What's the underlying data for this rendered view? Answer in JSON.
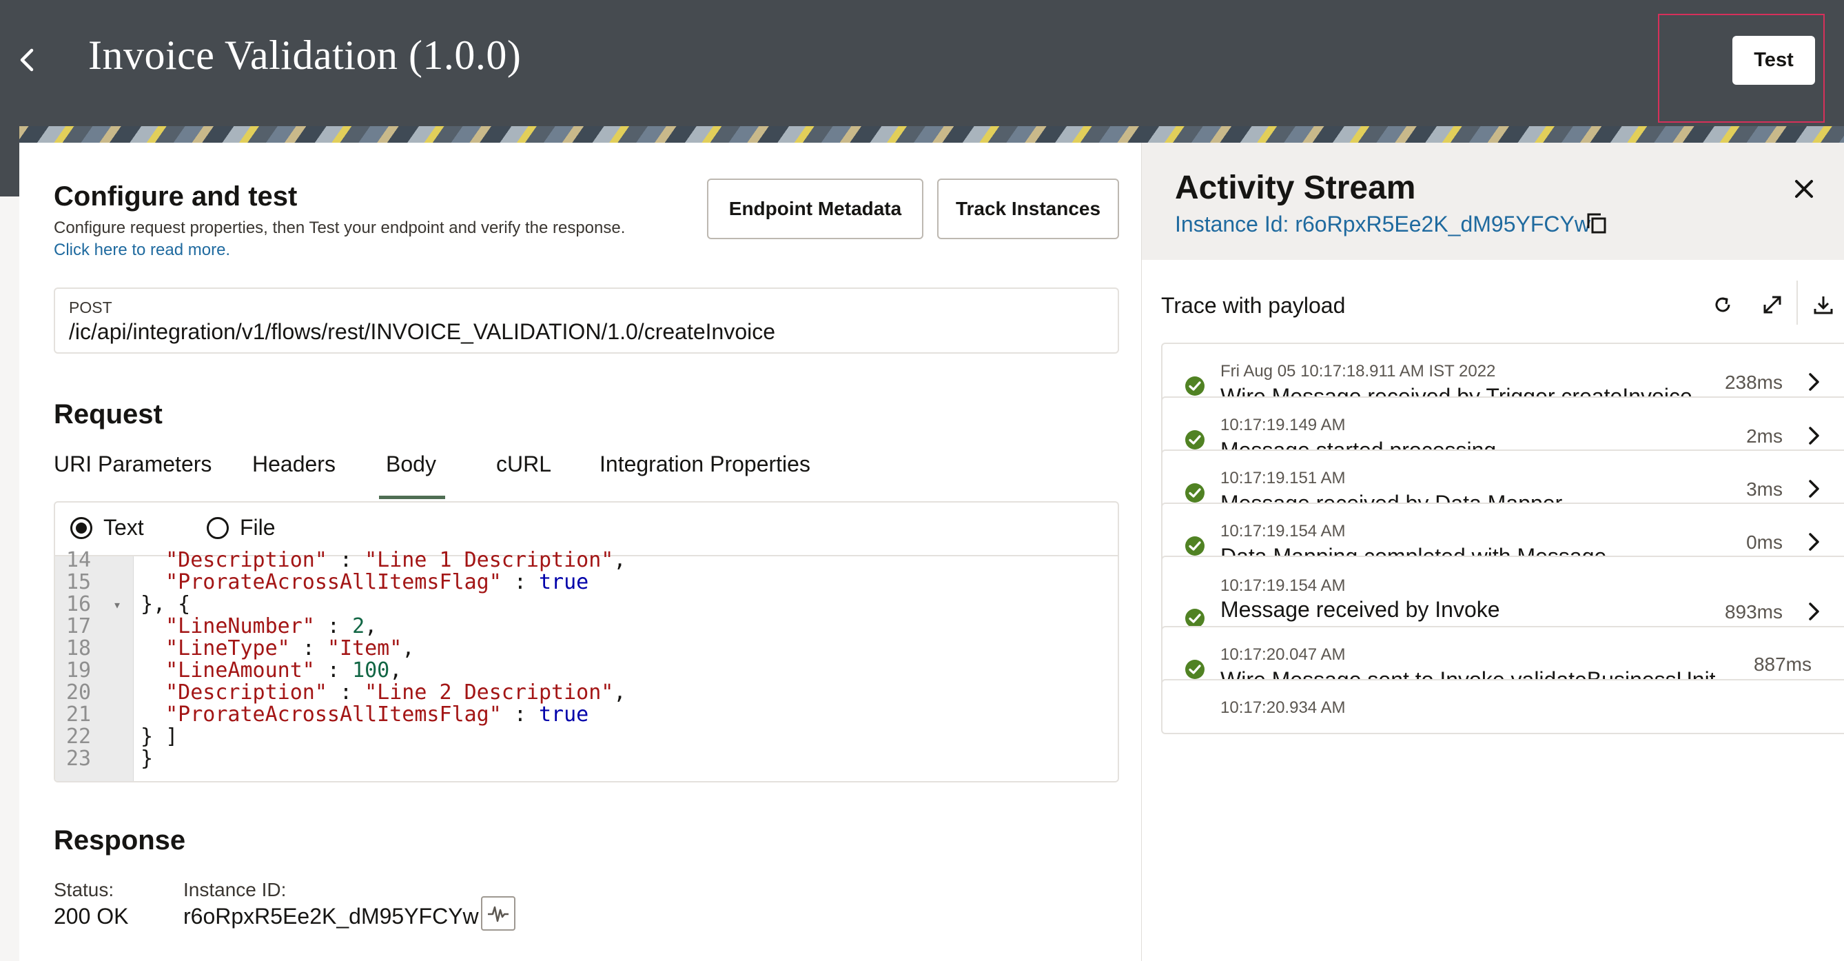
{
  "header": {
    "title": "Invoice Validation (1.0.0)",
    "test_label": "Test"
  },
  "configure": {
    "title": "Configure and test",
    "subtitle": "Configure request properties, then Test your endpoint and verify the response.",
    "read_more": "Click here to read more.",
    "endpoint_metadata_label": "Endpoint Metadata",
    "track_instances_label": "Track Instances"
  },
  "endpoint": {
    "method": "POST",
    "url": "/ic/api/integration/v1/flows/rest/INVOICE_VALIDATION/1.0/createInvoice"
  },
  "request": {
    "title": "Request",
    "tabs": [
      "URI Parameters",
      "Headers",
      "Body",
      "cURL",
      "Integration Properties"
    ],
    "active_tab": "Body",
    "body_type_options": [
      "Text",
      "File"
    ],
    "body_type_selected": "Text",
    "code_lines": [
      {
        "n": "14",
        "fold": false,
        "tokens": [
          {
            "t": "  ",
            "c": ""
          },
          {
            "t": "\"Description\"",
            "c": "s"
          },
          {
            "t": " : ",
            "c": ""
          },
          {
            "t": "\"Line 1 Description\"",
            "c": "s"
          },
          {
            "t": ",",
            "c": ""
          }
        ]
      },
      {
        "n": "15",
        "fold": false,
        "tokens": [
          {
            "t": "  ",
            "c": ""
          },
          {
            "t": "\"ProrateAcrossAllItemsFlag\"",
            "c": "s"
          },
          {
            "t": " : ",
            "c": ""
          },
          {
            "t": "true",
            "c": "b"
          }
        ]
      },
      {
        "n": "16",
        "fold": true,
        "tokens": [
          {
            "t": "}, {",
            "c": ""
          }
        ]
      },
      {
        "n": "17",
        "fold": false,
        "tokens": [
          {
            "t": "  ",
            "c": ""
          },
          {
            "t": "\"LineNumber\"",
            "c": "s"
          },
          {
            "t": " : ",
            "c": ""
          },
          {
            "t": "2",
            "c": "n"
          },
          {
            "t": ",",
            "c": ""
          }
        ]
      },
      {
        "n": "18",
        "fold": false,
        "tokens": [
          {
            "t": "  ",
            "c": ""
          },
          {
            "t": "\"LineType\"",
            "c": "s"
          },
          {
            "t": " : ",
            "c": ""
          },
          {
            "t": "\"Item\"",
            "c": "s"
          },
          {
            "t": ",",
            "c": ""
          }
        ]
      },
      {
        "n": "19",
        "fold": false,
        "tokens": [
          {
            "t": "  ",
            "c": ""
          },
          {
            "t": "\"LineAmount\"",
            "c": "s"
          },
          {
            "t": " : ",
            "c": ""
          },
          {
            "t": "100",
            "c": "n"
          },
          {
            "t": ",",
            "c": ""
          }
        ]
      },
      {
        "n": "20",
        "fold": false,
        "tokens": [
          {
            "t": "  ",
            "c": ""
          },
          {
            "t": "\"Description\"",
            "c": "s"
          },
          {
            "t": " : ",
            "c": ""
          },
          {
            "t": "\"Line 2 Description\"",
            "c": "s"
          },
          {
            "t": ",",
            "c": ""
          }
        ]
      },
      {
        "n": "21",
        "fold": false,
        "tokens": [
          {
            "t": "  ",
            "c": ""
          },
          {
            "t": "\"ProrateAcrossAllItemsFlag\"",
            "c": "s"
          },
          {
            "t": " : ",
            "c": ""
          },
          {
            "t": "true",
            "c": "b"
          }
        ]
      },
      {
        "n": "22",
        "fold": false,
        "tokens": [
          {
            "t": "} ]",
            "c": ""
          }
        ]
      },
      {
        "n": "23",
        "fold": false,
        "tokens": [
          {
            "t": "}",
            "c": ""
          }
        ]
      }
    ]
  },
  "response": {
    "title": "Response",
    "status_label": "Status:",
    "status_value": "200 OK",
    "instance_label": "Instance ID:",
    "instance_value": "r6oRpxR5Ee2K_dM95YFCYw"
  },
  "activity": {
    "title": "Activity Stream",
    "instance_line": "Instance Id: r6oRpxR5Ee2K_dM95YFCYw",
    "trace_label": "Trace with payload",
    "items": [
      {
        "ts": "Fri Aug 05 10:17:18.911 AM IST 2022",
        "msg": "Wire Message received by Trigger createInvoice",
        "dur": "238ms",
        "status": "success"
      },
      {
        "ts": "10:17:19.149 AM",
        "msg": "Message started processing",
        "dur": "2ms",
        "status": "success"
      },
      {
        "ts": "10:17:19.151 AM",
        "msg": "Message received by Data Mapper",
        "dur": "3ms",
        "status": "success"
      },
      {
        "ts": "10:17:19.154 AM",
        "msg": "Data Mapping completed with Message",
        "dur": "0ms",
        "status": "success"
      },
      {
        "ts": "10:17:19.154 AM",
        "msg": "Message received by Invoke validateBusinessUnit",
        "dur": "893ms",
        "status": "success"
      },
      {
        "ts": "10:17:20.047 AM",
        "msg": "Wire Message sent to Invoke validateBusinessUnit",
        "dur": "887ms",
        "status": "success"
      },
      {
        "ts": "10:17:20.934 AM",
        "msg": "",
        "dur": "",
        "status": "success"
      }
    ]
  },
  "colors": {
    "header_bg": "#464b50",
    "accent_link": "#1f6a9f",
    "success": "#508223",
    "tab_underline": "#4f6e53",
    "highlight": "#d6305a"
  },
  "icons": [
    "chevron-left-icon",
    "copy-icon",
    "close-icon",
    "refresh-icon",
    "expand-icon",
    "download-icon",
    "check-circle-icon",
    "chevron-right-icon",
    "activity-pulse-icon"
  ]
}
